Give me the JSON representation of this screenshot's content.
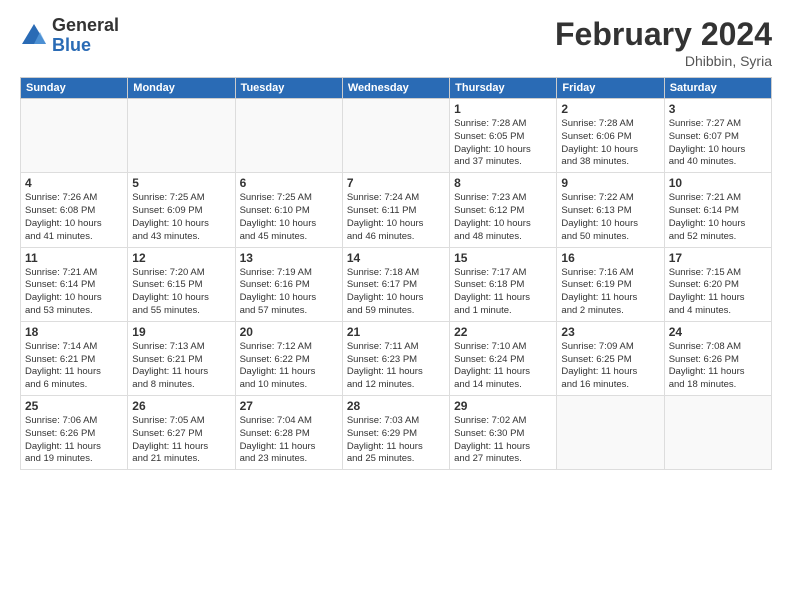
{
  "logo": {
    "general": "General",
    "blue": "Blue"
  },
  "title": "February 2024",
  "location": "Dhibbin, Syria",
  "days_of_week": [
    "Sunday",
    "Monday",
    "Tuesday",
    "Wednesday",
    "Thursday",
    "Friday",
    "Saturday"
  ],
  "weeks": [
    [
      {
        "day": "",
        "info": ""
      },
      {
        "day": "",
        "info": ""
      },
      {
        "day": "",
        "info": ""
      },
      {
        "day": "",
        "info": ""
      },
      {
        "day": "1",
        "info": "Sunrise: 7:28 AM\nSunset: 6:05 PM\nDaylight: 10 hours\nand 37 minutes."
      },
      {
        "day": "2",
        "info": "Sunrise: 7:28 AM\nSunset: 6:06 PM\nDaylight: 10 hours\nand 38 minutes."
      },
      {
        "day": "3",
        "info": "Sunrise: 7:27 AM\nSunset: 6:07 PM\nDaylight: 10 hours\nand 40 minutes."
      }
    ],
    [
      {
        "day": "4",
        "info": "Sunrise: 7:26 AM\nSunset: 6:08 PM\nDaylight: 10 hours\nand 41 minutes."
      },
      {
        "day": "5",
        "info": "Sunrise: 7:25 AM\nSunset: 6:09 PM\nDaylight: 10 hours\nand 43 minutes."
      },
      {
        "day": "6",
        "info": "Sunrise: 7:25 AM\nSunset: 6:10 PM\nDaylight: 10 hours\nand 45 minutes."
      },
      {
        "day": "7",
        "info": "Sunrise: 7:24 AM\nSunset: 6:11 PM\nDaylight: 10 hours\nand 46 minutes."
      },
      {
        "day": "8",
        "info": "Sunrise: 7:23 AM\nSunset: 6:12 PM\nDaylight: 10 hours\nand 48 minutes."
      },
      {
        "day": "9",
        "info": "Sunrise: 7:22 AM\nSunset: 6:13 PM\nDaylight: 10 hours\nand 50 minutes."
      },
      {
        "day": "10",
        "info": "Sunrise: 7:21 AM\nSunset: 6:14 PM\nDaylight: 10 hours\nand 52 minutes."
      }
    ],
    [
      {
        "day": "11",
        "info": "Sunrise: 7:21 AM\nSunset: 6:14 PM\nDaylight: 10 hours\nand 53 minutes."
      },
      {
        "day": "12",
        "info": "Sunrise: 7:20 AM\nSunset: 6:15 PM\nDaylight: 10 hours\nand 55 minutes."
      },
      {
        "day": "13",
        "info": "Sunrise: 7:19 AM\nSunset: 6:16 PM\nDaylight: 10 hours\nand 57 minutes."
      },
      {
        "day": "14",
        "info": "Sunrise: 7:18 AM\nSunset: 6:17 PM\nDaylight: 10 hours\nand 59 minutes."
      },
      {
        "day": "15",
        "info": "Sunrise: 7:17 AM\nSunset: 6:18 PM\nDaylight: 11 hours\nand 1 minute."
      },
      {
        "day": "16",
        "info": "Sunrise: 7:16 AM\nSunset: 6:19 PM\nDaylight: 11 hours\nand 2 minutes."
      },
      {
        "day": "17",
        "info": "Sunrise: 7:15 AM\nSunset: 6:20 PM\nDaylight: 11 hours\nand 4 minutes."
      }
    ],
    [
      {
        "day": "18",
        "info": "Sunrise: 7:14 AM\nSunset: 6:21 PM\nDaylight: 11 hours\nand 6 minutes."
      },
      {
        "day": "19",
        "info": "Sunrise: 7:13 AM\nSunset: 6:21 PM\nDaylight: 11 hours\nand 8 minutes."
      },
      {
        "day": "20",
        "info": "Sunrise: 7:12 AM\nSunset: 6:22 PM\nDaylight: 11 hours\nand 10 minutes."
      },
      {
        "day": "21",
        "info": "Sunrise: 7:11 AM\nSunset: 6:23 PM\nDaylight: 11 hours\nand 12 minutes."
      },
      {
        "day": "22",
        "info": "Sunrise: 7:10 AM\nSunset: 6:24 PM\nDaylight: 11 hours\nand 14 minutes."
      },
      {
        "day": "23",
        "info": "Sunrise: 7:09 AM\nSunset: 6:25 PM\nDaylight: 11 hours\nand 16 minutes."
      },
      {
        "day": "24",
        "info": "Sunrise: 7:08 AM\nSunset: 6:26 PM\nDaylight: 11 hours\nand 18 minutes."
      }
    ],
    [
      {
        "day": "25",
        "info": "Sunrise: 7:06 AM\nSunset: 6:26 PM\nDaylight: 11 hours\nand 19 minutes."
      },
      {
        "day": "26",
        "info": "Sunrise: 7:05 AM\nSunset: 6:27 PM\nDaylight: 11 hours\nand 21 minutes."
      },
      {
        "day": "27",
        "info": "Sunrise: 7:04 AM\nSunset: 6:28 PM\nDaylight: 11 hours\nand 23 minutes."
      },
      {
        "day": "28",
        "info": "Sunrise: 7:03 AM\nSunset: 6:29 PM\nDaylight: 11 hours\nand 25 minutes."
      },
      {
        "day": "29",
        "info": "Sunrise: 7:02 AM\nSunset: 6:30 PM\nDaylight: 11 hours\nand 27 minutes."
      },
      {
        "day": "",
        "info": ""
      },
      {
        "day": "",
        "info": ""
      }
    ]
  ]
}
